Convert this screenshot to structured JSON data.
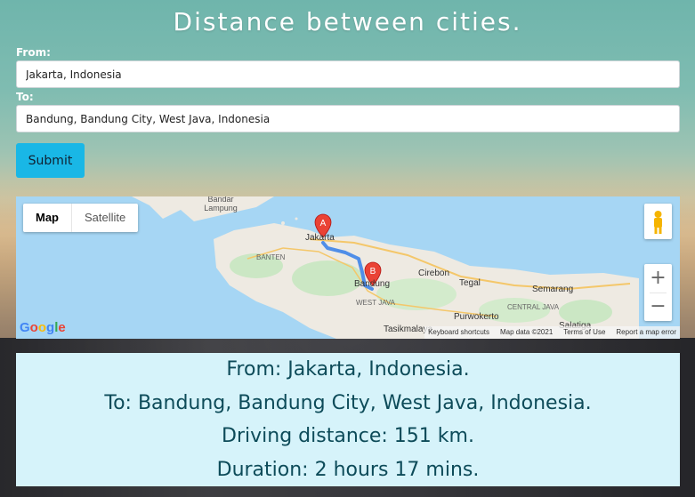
{
  "page": {
    "title": "Distance between cities."
  },
  "form": {
    "from_label": "From:",
    "from_value": "Jakarta, Indonesia",
    "to_label": "To:",
    "to_value": "Bandung, Bandung City, West Java, Indonesia",
    "submit_label": "Submit"
  },
  "map": {
    "map_type_options": [
      "Map",
      "Satellite"
    ],
    "active_map_type": "Map",
    "zoom_in": "+",
    "zoom_out": "−",
    "place_labels": {
      "bandar_lampung": "Bandar Lampung",
      "banten": "BANTEN",
      "jakarta": "Jakarta",
      "bandung": "Bandung",
      "west_java": "WEST JAVA",
      "cirebon": "Cirebon",
      "tegal": "Tegal",
      "semarang": "Semarang",
      "central_java": "CENTRAL JAVA",
      "purwokerto": "Purwokerto",
      "tasikmalaya": "Tasikmalaya",
      "salatiga": "Salatiga"
    },
    "markers": {
      "start": "A",
      "end": "B"
    },
    "logo_text": "Google",
    "attribution": {
      "shortcuts": "Keyboard shortcuts",
      "map_data": "Map data ©2021",
      "terms": "Terms of Use",
      "report": "Report a map error"
    },
    "colors": {
      "water": "#a6d6f4",
      "land": "#eeeae2",
      "route": "#4f8ee8",
      "marker": "#ea4335"
    }
  },
  "results": {
    "from_line": "From: Jakarta, Indonesia.",
    "to_line": "To: Bandung, Bandung City, West Java, Indonesia.",
    "distance_line": "Driving distance: 151 km.",
    "duration_line": "Duration: 2 hours 17 mins."
  },
  "colors": {
    "submit_button": "#19b7e6",
    "results_background": "#d6f3fa",
    "results_text": "#0d4b59"
  }
}
